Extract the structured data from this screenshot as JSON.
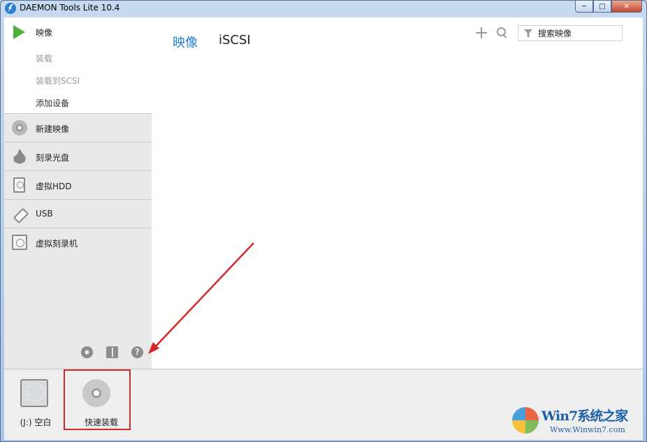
{
  "window": {
    "title": "DAEMON Tools Lite 10.4",
    "min_glyph": "─",
    "max_glyph": "□",
    "close_glyph": "✕"
  },
  "sidebar": {
    "main_item": "映像",
    "sub_items": [
      "装载",
      "装载到SCSI",
      "添加设备"
    ],
    "rows": [
      {
        "label": "新建映像",
        "icon": "disc-icon"
      },
      {
        "label": "刻录光盘",
        "icon": "flame-icon"
      },
      {
        "label": "虚拟HDD",
        "icon": "hdd-icon"
      },
      {
        "label": "USB",
        "icon": "usb-icon"
      },
      {
        "label": "虚拟刻录机",
        "icon": "virtual-burner-icon"
      }
    ],
    "help_glyph": "?"
  },
  "main": {
    "tabs": [
      "映像",
      "iSCSI"
    ],
    "search_placeholder": "搜索映像"
  },
  "tray": {
    "drives": [
      {
        "label": "(J:) 空白",
        "icon": "empty-drive-icon"
      },
      {
        "label": "快速装载",
        "icon": "quick-mount-icon"
      }
    ]
  },
  "watermark": {
    "title": "Win7系统之家",
    "url": "Www.Winwin7.com"
  },
  "colors": {
    "accent": "#1e7fd1",
    "play": "#4caf3a",
    "highlight": "#d62828"
  }
}
